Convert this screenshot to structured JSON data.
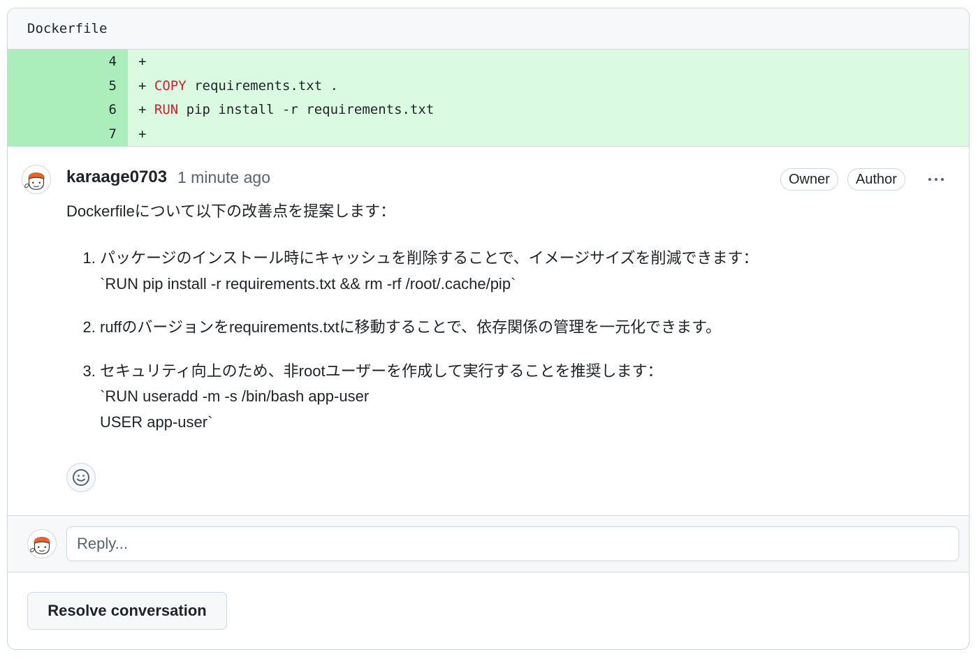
{
  "file": {
    "name": "Dockerfile"
  },
  "diff": {
    "lines": [
      {
        "num": "4",
        "prefix": "+",
        "keyword": "",
        "rest": ""
      },
      {
        "num": "5",
        "prefix": "+",
        "keyword": "COPY",
        "rest": " requirements.txt ."
      },
      {
        "num": "6",
        "prefix": "+",
        "keyword": "RUN",
        "rest": " pip install -r requirements.txt"
      },
      {
        "num": "7",
        "prefix": "+",
        "keyword": "",
        "rest": ""
      }
    ],
    "added_bg": "#dafbe1",
    "keyword_color": "#cf222e"
  },
  "comment": {
    "author": "karaage0703",
    "time": "1 minute ago",
    "badges": [
      "Owner",
      "Author"
    ],
    "intro": "Dockerfileについて以下の改善点を提案します：",
    "items": [
      {
        "lines": [
          "パッケージのインストール時にキャッシュを削除することで、イメージサイズを削減できます：",
          "`RUN pip install -r requirements.txt && rm -rf /root/.cache/pip`"
        ]
      },
      {
        "lines": [
          "ruffのバージョンをrequirements.txtに移動することで、依存関係の管理を一元化できます。"
        ]
      },
      {
        "lines": [
          "セキュリティ向上のため、非rootユーザーを作成して実行することを推奨します：",
          "`RUN useradd -m -s /bin/bash app-user",
          "USER app-user`"
        ]
      }
    ]
  },
  "icons": {
    "reaction": "smiley-icon",
    "more": "kebab-horizontal-icon"
  },
  "reply": {
    "placeholder": "Reply..."
  },
  "actions": {
    "resolve_label": "Resolve conversation"
  }
}
